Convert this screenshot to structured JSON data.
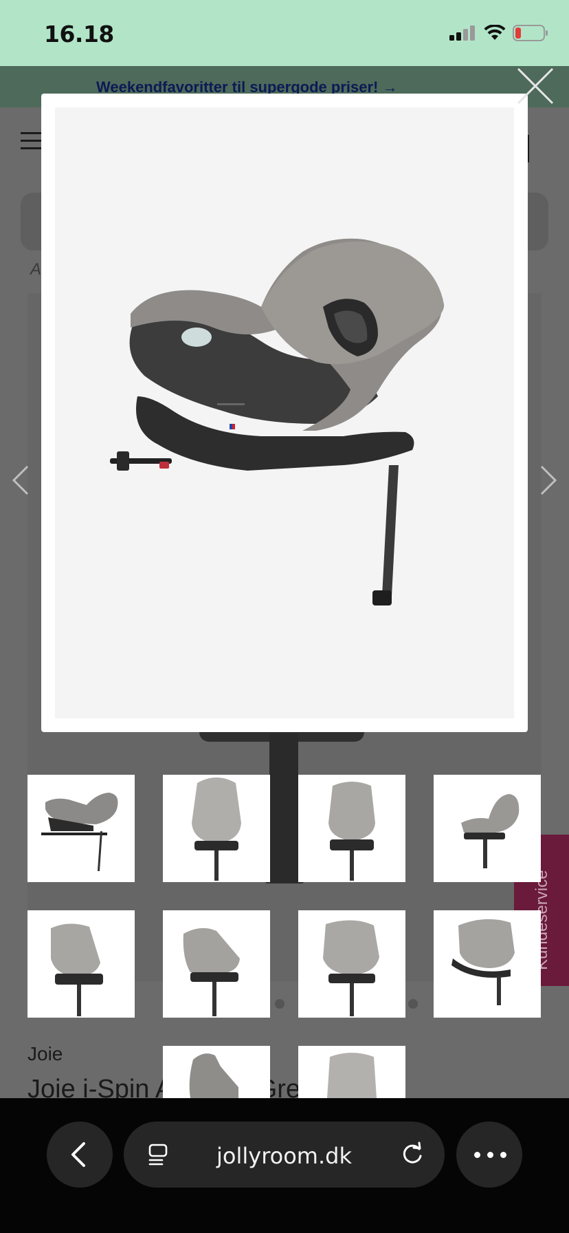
{
  "status_bar": {
    "time": "16.18"
  },
  "promo": {
    "text": "Weekendfavoritter til supergode priser! →"
  },
  "breadcrumb": {
    "text": "A"
  },
  "product": {
    "brand": "Joie",
    "title": "Joie i-Spin Autostol Grey"
  },
  "side_tab": {
    "label": "Kundeservice"
  },
  "browser": {
    "url": "jollyroom.dk"
  },
  "colors": {
    "status_bar_bg": "#b2e5c8",
    "promo_text": "#0c1a55",
    "kundeservice_bg": "#6a1a3a",
    "overlay": "#6b6b6b"
  },
  "icons": {
    "close": "close-icon",
    "prev": "chevron-left-icon",
    "next": "chevron-right-icon",
    "back": "back-arrow-icon",
    "tabs": "tabs-icon",
    "reload": "reload-icon",
    "more": "more-dots-icon",
    "menu": "hamburger-menu-icon"
  }
}
